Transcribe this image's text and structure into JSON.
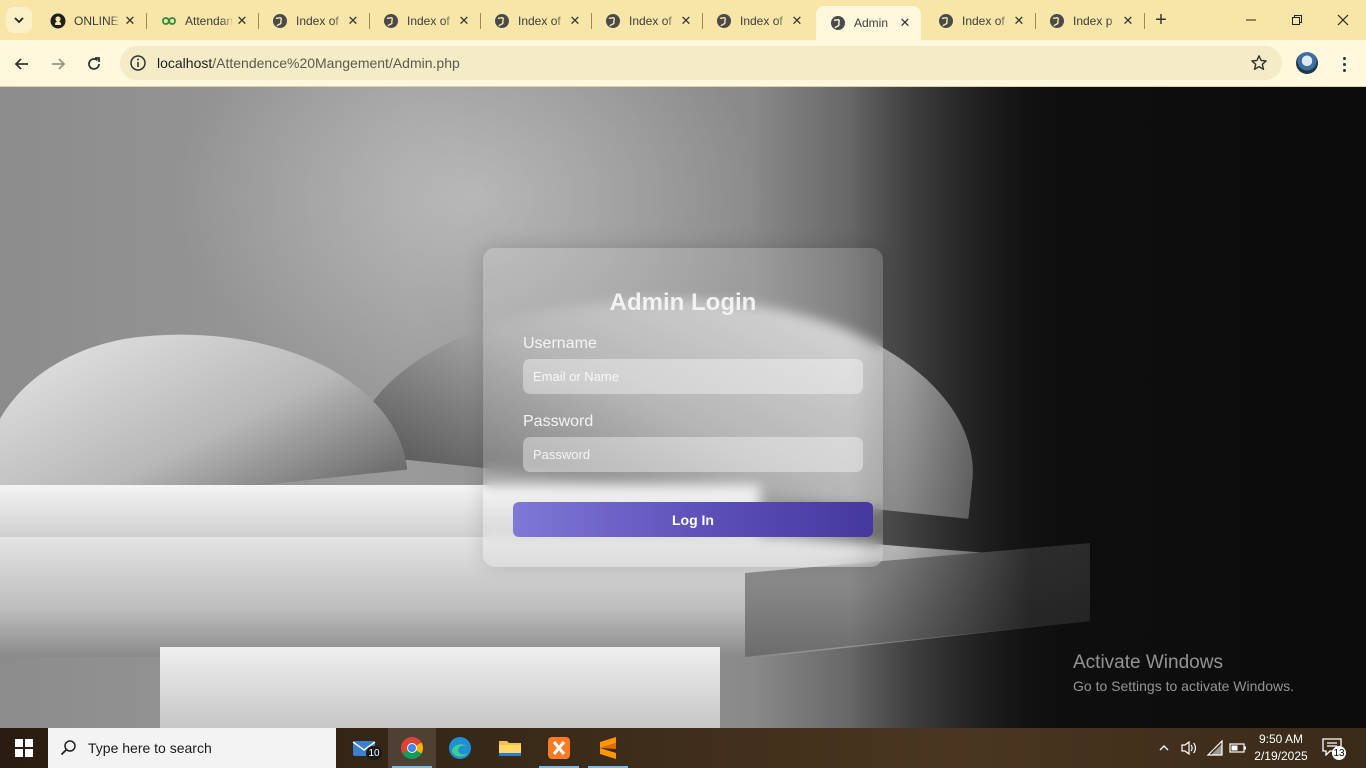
{
  "browser": {
    "tabs": [
      {
        "label": "ONLINE",
        "icon": "github-icon"
      },
      {
        "label": "Attendance",
        "icon": "infinity-icon"
      },
      {
        "label": "Index of",
        "icon": "globe-icon"
      },
      {
        "label": "Index of",
        "icon": "globe-icon"
      },
      {
        "label": "Index of",
        "icon": "globe-icon"
      },
      {
        "label": "Index of",
        "icon": "globe-icon"
      },
      {
        "label": "Index of",
        "icon": "globe-icon"
      },
      {
        "label": "Admin",
        "icon": "globe-icon",
        "active": true
      },
      {
        "label": "Index of",
        "icon": "globe-icon"
      },
      {
        "label": "Index p",
        "icon": "globe-icon"
      }
    ],
    "url_host": "localhost",
    "url_path": "/Attendence%20Mangement/Admin.php",
    "accent": "#f7e6a8"
  },
  "login": {
    "title": "Admin Login",
    "username_label": "Username",
    "username_placeholder": "Email or Name",
    "password_label": "Password",
    "password_placeholder": "Password",
    "button_label": "Log In",
    "button_color": "#5b4fb8"
  },
  "watermark": {
    "line1": "Activate Windows",
    "line2": "Go to Settings to activate Windows."
  },
  "taskbar": {
    "search_placeholder": "Type here to search",
    "mail_badge": "10",
    "time": "9:50 AM",
    "date": "2/19/2025",
    "notification_count": "13"
  }
}
